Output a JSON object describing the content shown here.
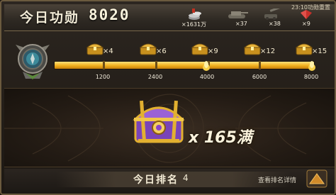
{
  "header": {
    "title": "今日功勋",
    "score": "8020",
    "reset_text": "23:10功勋重置",
    "items": [
      {
        "icon": "silver-coins-icon",
        "count": "×1631万"
      },
      {
        "icon": "tank-icon",
        "count": "×37"
      },
      {
        "icon": "artillery-icon",
        "count": "×38"
      },
      {
        "icon": "red-gem-icon",
        "count": "×9"
      }
    ]
  },
  "progress": {
    "current": 8020,
    "max": 8000,
    "milestones": [
      {
        "value": "1200",
        "multiplier": "×4"
      },
      {
        "value": "2400",
        "multiplier": "×6"
      },
      {
        "value": "4000",
        "multiplier": "×9"
      },
      {
        "value": "6000",
        "multiplier": "×12"
      },
      {
        "value": "8000",
        "multiplier": "×15"
      }
    ]
  },
  "reward": {
    "multiplier": "x 165",
    "full": "满"
  },
  "footer": {
    "rank_label": "今日排名",
    "rank_value": "4",
    "details_link": "查看排名详情"
  },
  "colors": {
    "gold": "#f2b01e",
    "purple": "#8a55c8",
    "frame": "#6b5a3e"
  }
}
